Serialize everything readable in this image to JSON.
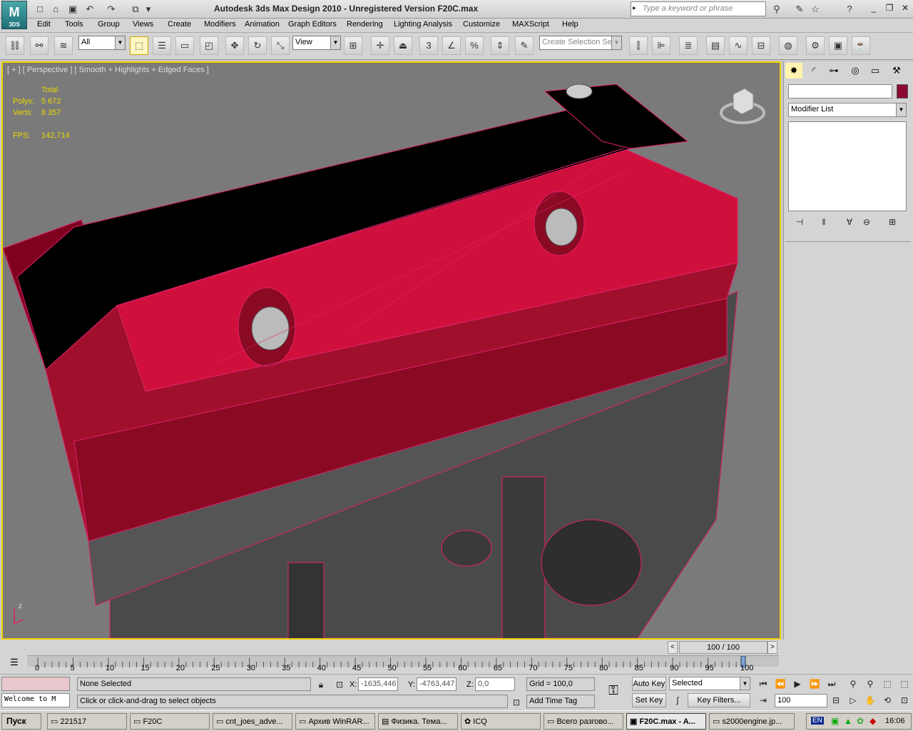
{
  "window": {
    "title": "Autodesk 3ds Max Design 2010  - Unregistered Version    F20C.max",
    "logo_letter": "M",
    "logo_caption": "3DS"
  },
  "search": {
    "placeholder": "Type a keyword or phrase"
  },
  "menu": [
    "Edit",
    "Tools",
    "Group",
    "Views",
    "Create",
    "Modifiers",
    "Animation",
    "Graph Editors",
    "Rendering",
    "Lighting Analysis",
    "Customize",
    "MAXScript",
    "Help"
  ],
  "toolbar": {
    "selection_filter": "All",
    "reference_coord": "View",
    "named_selection_placeholder": "Create Selection Se",
    "snap_label": "3",
    "percent_snap_label": "%"
  },
  "viewport": {
    "label": "[ + ] [ Perspective ] [ Smooth + Highlights + Edged Faces ]",
    "stats": {
      "total_label": "Total",
      "polys_label": "Polys:",
      "polys_value": "5 672",
      "verts_label": "Verts:",
      "verts_value": "8 357",
      "fps_label": "FPS:",
      "fps_value": "142,714"
    },
    "axis_label": "z"
  },
  "command_panel": {
    "name_value": "",
    "modifier_list": "Modifier List"
  },
  "timeline": {
    "frame_readout": "100 / 100",
    "ticks": [
      "0",
      "5",
      "10",
      "15",
      "20",
      "25",
      "30",
      "35",
      "40",
      "45",
      "50",
      "55",
      "60",
      "65",
      "70",
      "75",
      "80",
      "85",
      "90",
      "95",
      "100"
    ],
    "current_frame": 100,
    "total_frames": 100
  },
  "status": {
    "maxscript_listener": "",
    "maxscript_welcome": "Welcome to M",
    "selection_status": "None Selected",
    "prompt": "Click or click-and-drag to select objects",
    "x_label": "X:",
    "x_value": "-1635,446",
    "y_label": "Y:",
    "y_value": "-4763,447",
    "z_label": "Z:",
    "z_value": "0,0",
    "grid": "Grid = 100,0",
    "add_time_tag": "Add Time Tag",
    "auto_key": "Auto Key",
    "set_key": "Set Key",
    "key_mode": "Selected",
    "key_filters": "Key Filters...",
    "current_frame_field": "100"
  },
  "taskbar": {
    "start": "Пуск",
    "tasks": [
      {
        "label": "221517"
      },
      {
        "label": "F20C"
      },
      {
        "label": "cnt_joes_adve..."
      },
      {
        "label": "Архив WinRAR..."
      },
      {
        "label": "Физика. Тема..."
      },
      {
        "label": "ICQ"
      },
      {
        "label": "Всего разгово..."
      },
      {
        "label": "F20C.max - A..."
      },
      {
        "label": "s2000engine.jp..."
      }
    ],
    "lang": "EN",
    "clock": "16:06"
  },
  "colors": {
    "viewport_bg": "#7a7a7a",
    "active_border": "#f0d200",
    "stats_text": "#e8d800",
    "engine_cover": "#d0103c",
    "wire": "#e0206a"
  }
}
